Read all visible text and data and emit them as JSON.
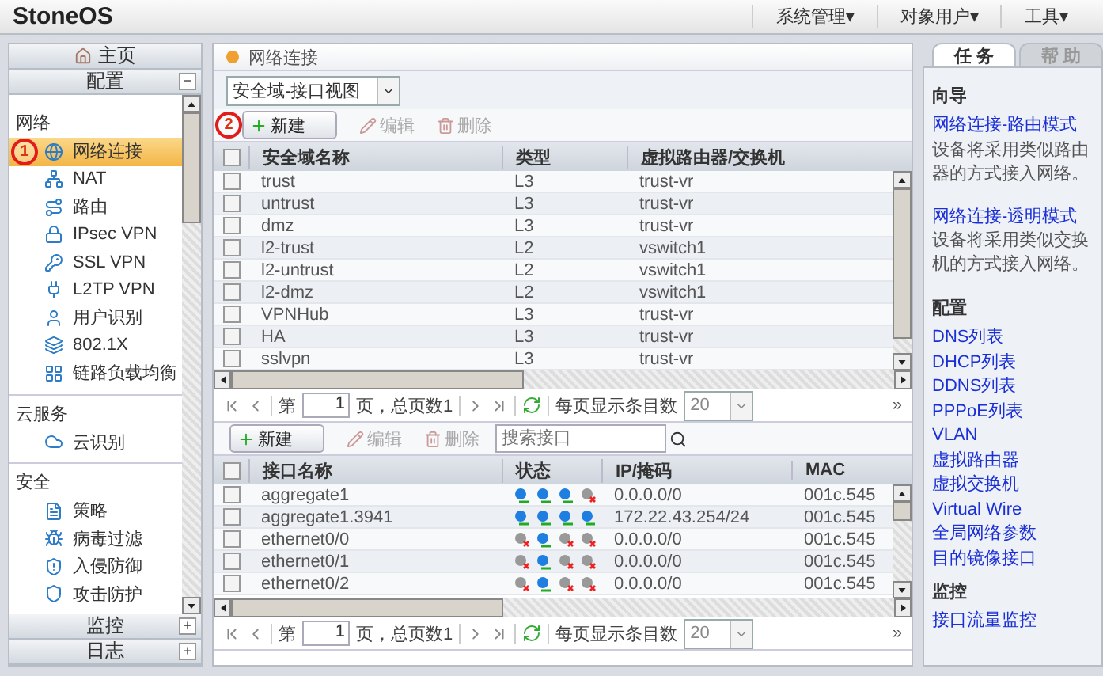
{
  "header": {
    "logo": "StoneOS",
    "menus": [
      "系统管理▾",
      "对象用户▾",
      "工具▾"
    ]
  },
  "sidebar": {
    "home": "主页",
    "config": {
      "label": "配置",
      "toggle": "−"
    },
    "groups": [
      {
        "label": "网络",
        "items": [
          {
            "label": "网络连接",
            "selected": true,
            "annotation": "1"
          },
          {
            "label": "NAT",
            "selected": false
          },
          {
            "label": "路由",
            "selected": false
          },
          {
            "label": "IPsec VPN",
            "selected": false
          },
          {
            "label": "SSL VPN",
            "selected": false
          },
          {
            "label": "L2TP VPN",
            "selected": false
          },
          {
            "label": "用户识别",
            "selected": false
          },
          {
            "label": "802.1X",
            "selected": false
          },
          {
            "label": "链路负载均衡",
            "selected": false
          }
        ]
      },
      {
        "label": "云服务",
        "items": [
          {
            "label": "云识别",
            "selected": false
          }
        ]
      },
      {
        "label": "安全",
        "items": [
          {
            "label": "策略",
            "selected": false
          },
          {
            "label": "病毒过滤",
            "selected": false
          },
          {
            "label": "入侵防御",
            "selected": false
          },
          {
            "label": "攻击防护",
            "selected": false
          }
        ]
      }
    ],
    "bottom": [
      {
        "label": "监控",
        "toggle": "+"
      },
      {
        "label": "日志",
        "toggle": "+"
      }
    ]
  },
  "main": {
    "title": "网络连接",
    "view_select": "安全域-接口视图",
    "zone_toolbar": {
      "annotation": "2",
      "buttons": [
        {
          "label": "新建",
          "disabled": false
        },
        {
          "label": "编辑",
          "disabled": true
        },
        {
          "label": "删除",
          "disabled": true
        }
      ]
    },
    "zone_table": {
      "all_checked": false,
      "columns": [
        "安全域名称",
        "类型",
        "虚拟路由器/交换机"
      ],
      "rows": [
        {
          "checked": false,
          "cells": [
            "trust",
            "L3",
            "trust-vr"
          ]
        },
        {
          "checked": false,
          "cells": [
            "untrust",
            "L3",
            "trust-vr"
          ]
        },
        {
          "checked": false,
          "cells": [
            "dmz",
            "L3",
            "trust-vr"
          ]
        },
        {
          "checked": false,
          "cells": [
            "l2-trust",
            "L2",
            "vswitch1"
          ]
        },
        {
          "checked": false,
          "cells": [
            "l2-untrust",
            "L2",
            "vswitch1"
          ]
        },
        {
          "checked": false,
          "cells": [
            "l2-dmz",
            "L2",
            "vswitch1"
          ]
        },
        {
          "checked": false,
          "cells": [
            "VPNHub",
            "L3",
            "trust-vr"
          ]
        },
        {
          "checked": false,
          "cells": [
            "HA",
            "L3",
            "trust-vr"
          ]
        },
        {
          "checked": false,
          "cells": [
            "sslvpn",
            "L3",
            "trust-vr"
          ]
        }
      ]
    },
    "pager1": {
      "prefix": "第",
      "page": "1",
      "suffix": "页，总页数1",
      "per_page_label": "每页显示条目数",
      "per_page": "20",
      "more": "»"
    },
    "iface_toolbar": {
      "buttons": [
        {
          "label": "新建",
          "disabled": false
        },
        {
          "label": "编辑",
          "disabled": true
        },
        {
          "label": "删除",
          "disabled": true
        }
      ],
      "search": {
        "placeholder": "搜索接口"
      }
    },
    "iface_table": {
      "all_checked": false,
      "columns": [
        "接口名称",
        "状态",
        "IP/掩码",
        "MAC"
      ],
      "rows": [
        {
          "checked": false,
          "name": "aggregate1",
          "status": [
            true,
            true,
            true,
            false
          ],
          "ip": "0.0.0.0/0",
          "mac": "001c.545"
        },
        {
          "checked": false,
          "name": "aggregate1.3941",
          "status": [
            true,
            true,
            true,
            true
          ],
          "ip": "172.22.43.254/24",
          "mac": "001c.545"
        },
        {
          "checked": false,
          "name": "ethernet0/0",
          "status": [
            false,
            true,
            false,
            false
          ],
          "ip": "0.0.0.0/0",
          "mac": "001c.545"
        },
        {
          "checked": false,
          "name": "ethernet0/1",
          "status": [
            false,
            true,
            false,
            false
          ],
          "ip": "0.0.0.0/0",
          "mac": "001c.545"
        },
        {
          "checked": false,
          "name": "ethernet0/2",
          "status": [
            false,
            true,
            false,
            false
          ],
          "ip": "0.0.0.0/0",
          "mac": "001c.545"
        }
      ]
    },
    "pager2": {
      "prefix": "第",
      "page": "1",
      "suffix": "页，总页数1",
      "per_page_label": "每页显示条目数",
      "per_page": "20",
      "more": "»"
    }
  },
  "right_panel": {
    "tabs": [
      {
        "label": "任 务",
        "selected": true
      },
      {
        "label": "帮 助",
        "selected": false
      }
    ],
    "sections": [
      {
        "title": "向导",
        "entries": [
          {
            "link": "网络连接-路由模式",
            "desc": "设备将采用类似路由器的方式接入网络。"
          },
          {
            "link": "网络连接-透明模式",
            "desc": "设备将采用类似交换机的方式接入网络。"
          }
        ]
      },
      {
        "title": "配置",
        "entries": [
          {
            "link": "DNS列表"
          },
          {
            "link": "DHCP列表"
          },
          {
            "link": "DDNS列表"
          },
          {
            "link": "PPPoE列表"
          },
          {
            "link": "VLAN"
          },
          {
            "link": "虚拟路由器"
          },
          {
            "link": "虚拟交换机"
          },
          {
            "link": "Virtual Wire"
          },
          {
            "link": "全局网络参数"
          },
          {
            "link": "目的镜像接口"
          }
        ]
      },
      {
        "title": "监控",
        "entries": [
          {
            "link": "接口流量监控"
          }
        ]
      }
    ]
  }
}
